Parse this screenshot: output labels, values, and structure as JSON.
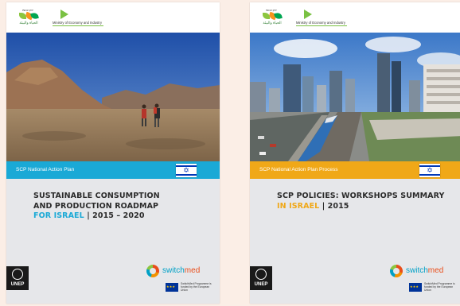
{
  "covers": [
    {
      "band_label": "SCP National Action Plan",
      "band_color": "#1aa9d6",
      "title_line1": "SUSTAINABLE CONSUMPTION",
      "title_line2": "AND PRODUCTION ROADMAP",
      "highlight": "FOR ISRAEL",
      "highlight_color": "#1aa9d6",
      "year_text": "| 2015 – 2020"
    },
    {
      "band_label": "SCP National Action Plan Process",
      "band_color": "#f0a818",
      "title_line1": "SCP POLICIES: WORKSHOPS SUMMARY",
      "title_line2": "",
      "highlight": "IN ISRAEL",
      "highlight_color": "#f0a818",
      "year_text": "| 2015"
    }
  ],
  "logos": {
    "partner_top_text": "ירוק עכשיו",
    "partner_arabic": "الحياة والبيئة",
    "ministry_text": "Ministry of Economy and Industry",
    "unep": "UNEP",
    "switch": "switch",
    "med": "med",
    "eu_text": "SwitchMed Programme is funded by the European Union"
  },
  "icons": {
    "flag": "israel-flag-icon",
    "star": "star-of-david-icon"
  }
}
